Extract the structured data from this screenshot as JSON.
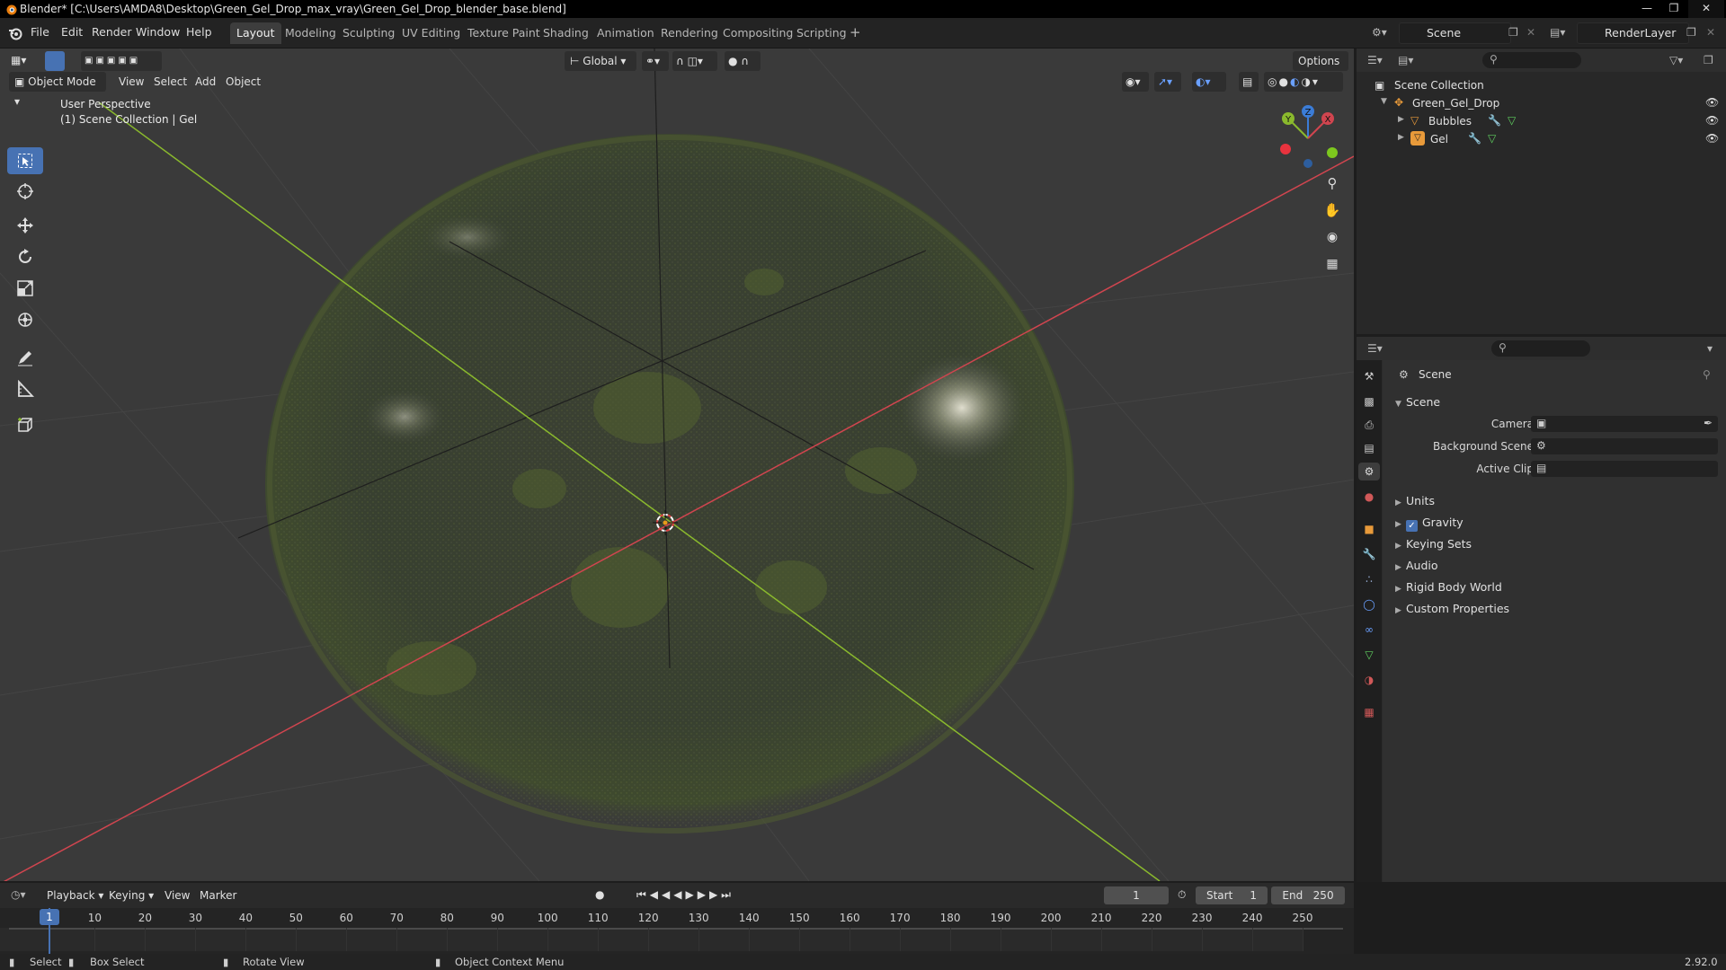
{
  "window": {
    "title": "Blender* [C:\\Users\\AMDA8\\Desktop\\Green_Gel_Drop_max_vray\\Green_Gel_Drop_blender_base.blend]"
  },
  "menubar": {
    "menus": [
      "File",
      "Edit",
      "Render",
      "Window",
      "Help"
    ],
    "workspaces": [
      "Layout",
      "Modeling",
      "Sculpting",
      "UV Editing",
      "Texture Paint",
      "Shading",
      "Animation",
      "Rendering",
      "Compositing",
      "Scripting"
    ],
    "active_workspace": "Layout",
    "scene_name": "Scene",
    "render_layer": "RenderLayer"
  },
  "viewport": {
    "mode": "Object Mode",
    "menus": [
      "View",
      "Select",
      "Add",
      "Object"
    ],
    "orientation": "Global",
    "options_label": "Options",
    "overlay_line1": "User Perspective",
    "overlay_line2": "(1) Scene Collection | Gel",
    "axis_labels": {
      "x": "X",
      "y": "Y",
      "z": "Z"
    }
  },
  "outliner": {
    "root": "Scene Collection",
    "items": [
      {
        "name": "Green_Gel_Drop"
      },
      {
        "name": "Bubbles"
      },
      {
        "name": "Gel"
      }
    ]
  },
  "properties": {
    "context": "Scene",
    "panel_title": "Scene",
    "fields": [
      {
        "label": "Camera"
      },
      {
        "label": "Background Scene"
      },
      {
        "label": "Active Clip"
      }
    ],
    "sections": [
      "Units",
      "Gravity",
      "Keying Sets",
      "Audio",
      "Rigid Body World",
      "Custom Properties"
    ],
    "gravity_checked": true
  },
  "timeline": {
    "menus": [
      "Playback",
      "Keying",
      "View",
      "Marker"
    ],
    "current_frame": "1",
    "start_label": "Start",
    "start_value": "1",
    "end_label": "End",
    "end_value": "250",
    "ticks": [
      "1",
      "10",
      "20",
      "30",
      "40",
      "50",
      "60",
      "70",
      "80",
      "90",
      "100",
      "110",
      "120",
      "130",
      "140",
      "150",
      "160",
      "170",
      "180",
      "190",
      "200",
      "210",
      "220",
      "230",
      "240",
      "250"
    ]
  },
  "statusbar": {
    "select": "Select",
    "box_select": "Box Select",
    "rotate_view": "Rotate View",
    "context_menu": "Object Context Menu",
    "version": "2.92.0"
  },
  "colors": {
    "accent": "#4772b3",
    "x_axis": "#d0454f",
    "y_axis": "#8ab92d",
    "z_axis": "#3b7cd6",
    "active_tab": "#3d3d3d"
  }
}
